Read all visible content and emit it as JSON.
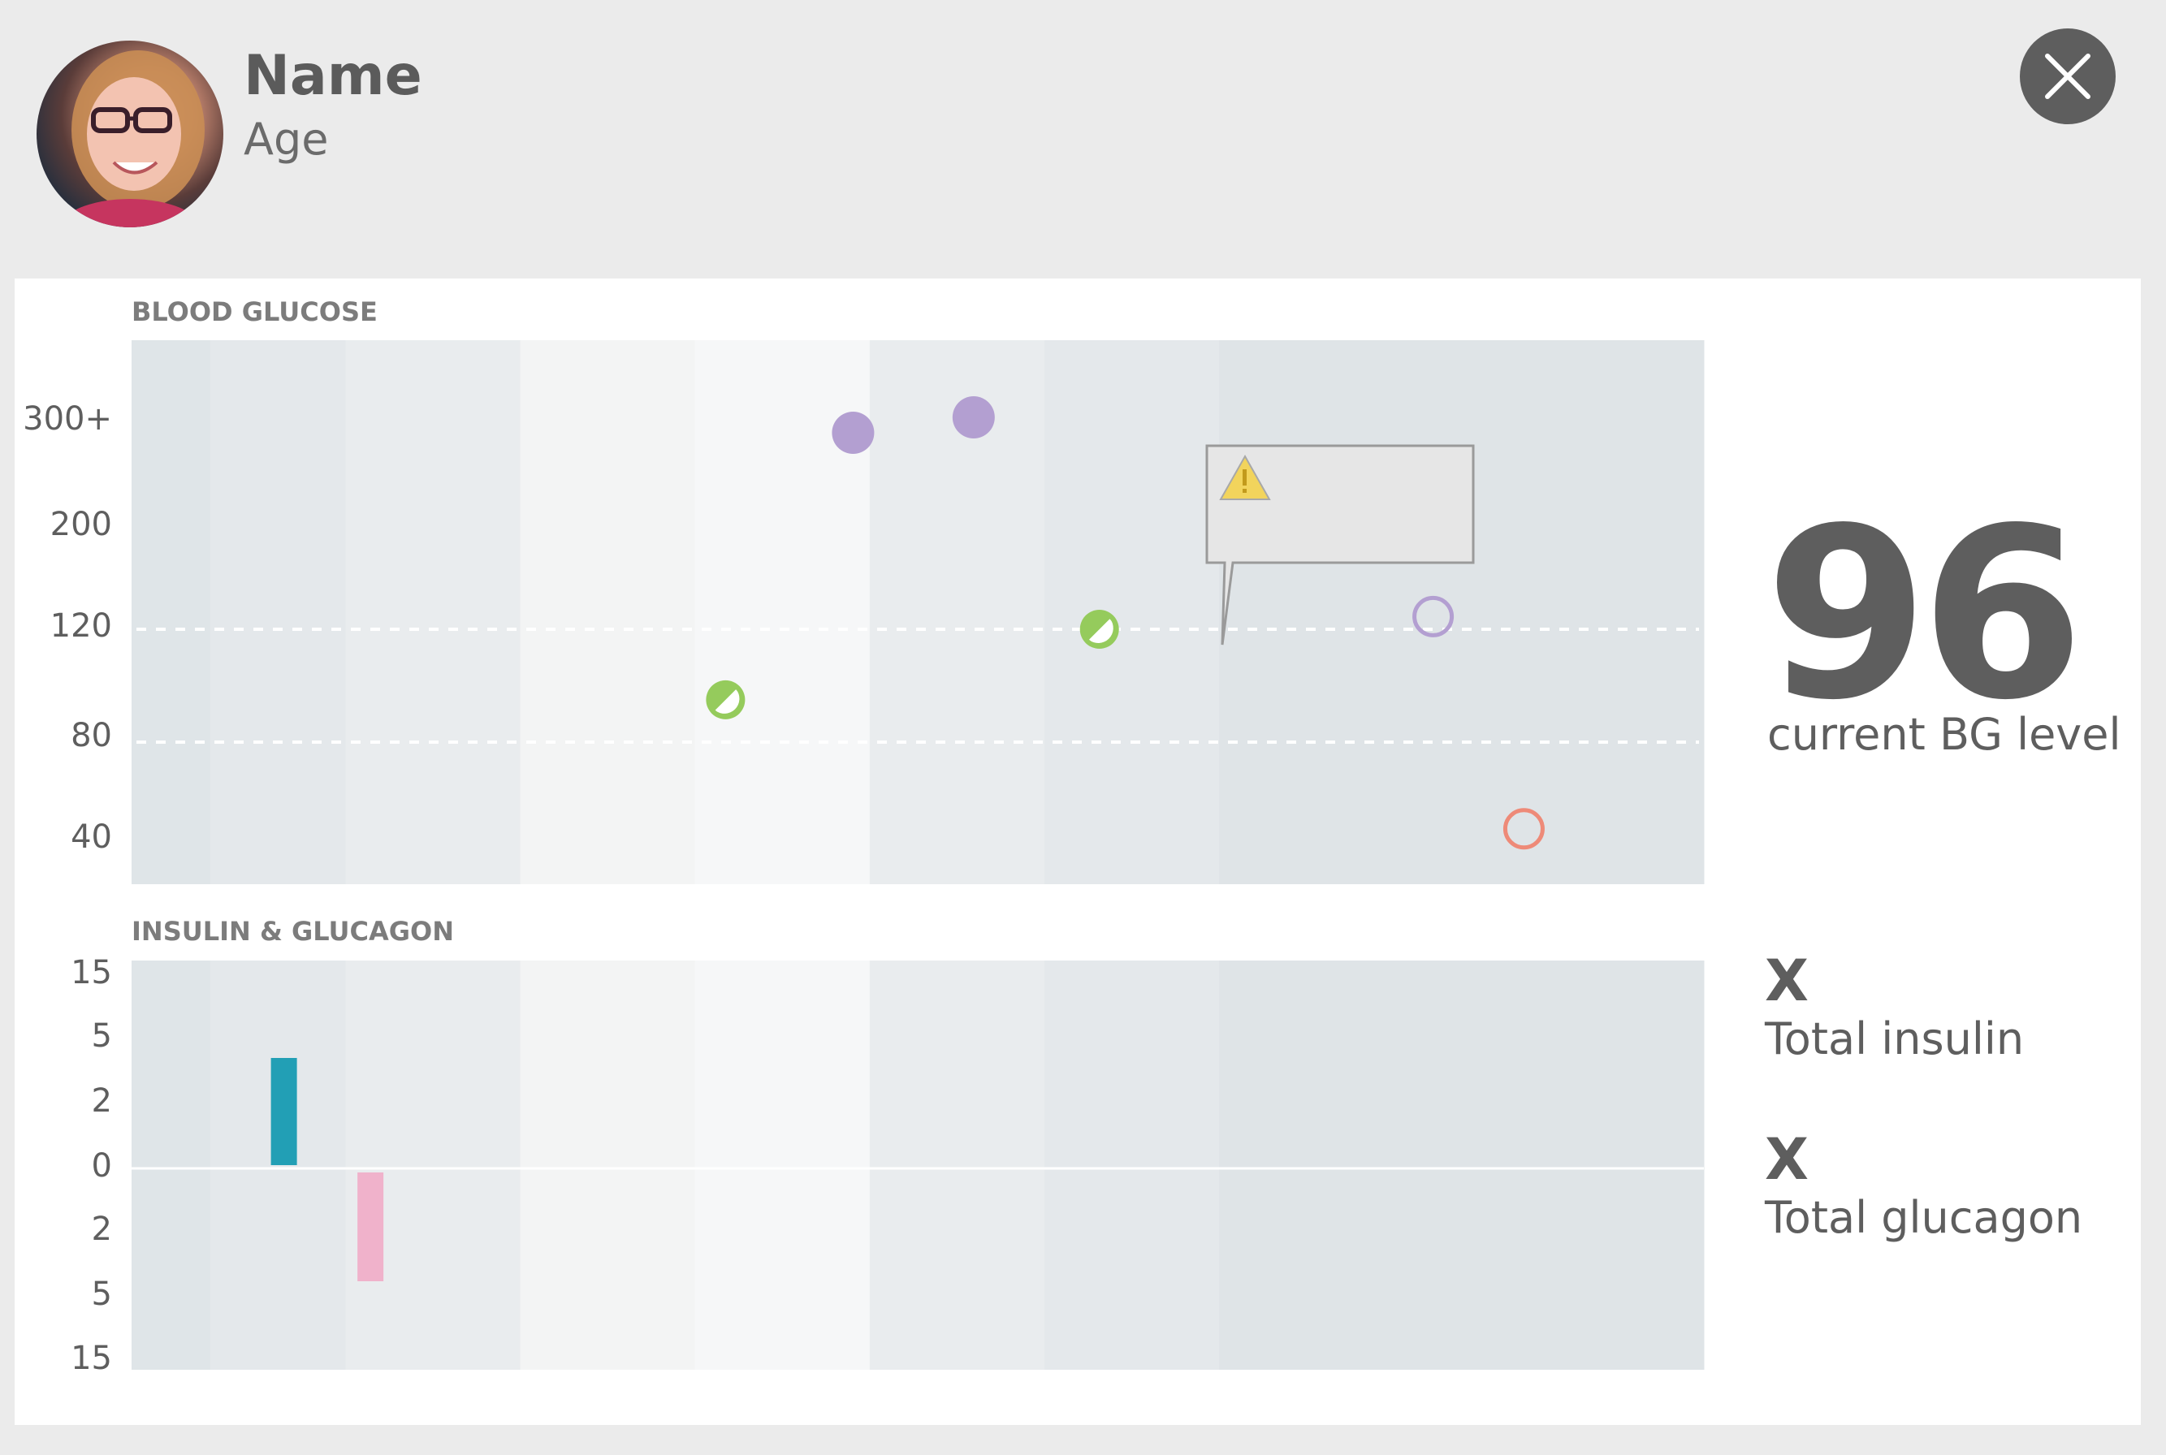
{
  "profile": {
    "name": "Name",
    "age": "Age"
  },
  "header": {
    "close_icon": "close-icon"
  },
  "blood_glucose": {
    "title": "BLOOD GLUCOSE",
    "current_value": "96",
    "current_label": "current BG level",
    "alert_icon": "warning-icon"
  },
  "insulin_glucagon": {
    "title": "INSULIN & GLUCAGON",
    "total_insulin_value": "X",
    "total_insulin_label": "Total insulin",
    "total_glucagon_value": "X",
    "total_glucagon_label": "Total glucagon"
  },
  "colors": {
    "text": "#5e5e5e",
    "chart_background": "#e4e8eb",
    "glucose_high": "#b39fd1",
    "glucose_normal": "#95cb5c",
    "glucose_low": "#ee8a78",
    "insulin": "#229fb5",
    "glucagon": "#f0b2cb",
    "alert": "#f2d45c"
  },
  "chart_data": [
    {
      "type": "scatter",
      "title": "BLOOD GLUCOSE",
      "y_ticks": [
        "300+",
        "200",
        "120",
        "80",
        "40"
      ],
      "y_tick_values": [
        300,
        200,
        120,
        80,
        40
      ],
      "target_lines": [
        80,
        120
      ],
      "points": [
        {
          "slot": 3.4,
          "value": 95,
          "marker": "half-filled",
          "color": "#95cb5c"
        },
        {
          "slot": 4.13,
          "value": 290,
          "marker": "filled",
          "color": "#b39fd1"
        },
        {
          "slot": 4.82,
          "value": 310,
          "marker": "filled",
          "color": "#b39fd1"
        },
        {
          "slot": 5.54,
          "value": 120,
          "marker": "half-filled",
          "color": "#95cb5c"
        },
        {
          "slot": 7.45,
          "value": 130,
          "marker": "hollow",
          "color": "#b39fd1"
        },
        {
          "slot": 7.97,
          "value": 45,
          "marker": "hollow",
          "color": "#ee8a78"
        }
      ],
      "time_slots": 9,
      "grid": false
    },
    {
      "type": "bar",
      "title": "INSULIN & GLUCAGON",
      "y_ticks_up": [
        "15",
        "5",
        "2",
        "0"
      ],
      "y_ticks_down": [
        "2",
        "5",
        "15"
      ],
      "tick_levels_up": [
        15,
        5,
        2,
        0
      ],
      "tick_levels_down": [
        2,
        5,
        15
      ],
      "series": [
        {
          "kind": "insulin",
          "slot": 0.9,
          "value": 5,
          "color": "#229fb5"
        },
        {
          "kind": "glucagon",
          "slot": 1.2,
          "value": 5,
          "color": "#f0b2cb"
        }
      ],
      "time_slots": 9
    }
  ]
}
